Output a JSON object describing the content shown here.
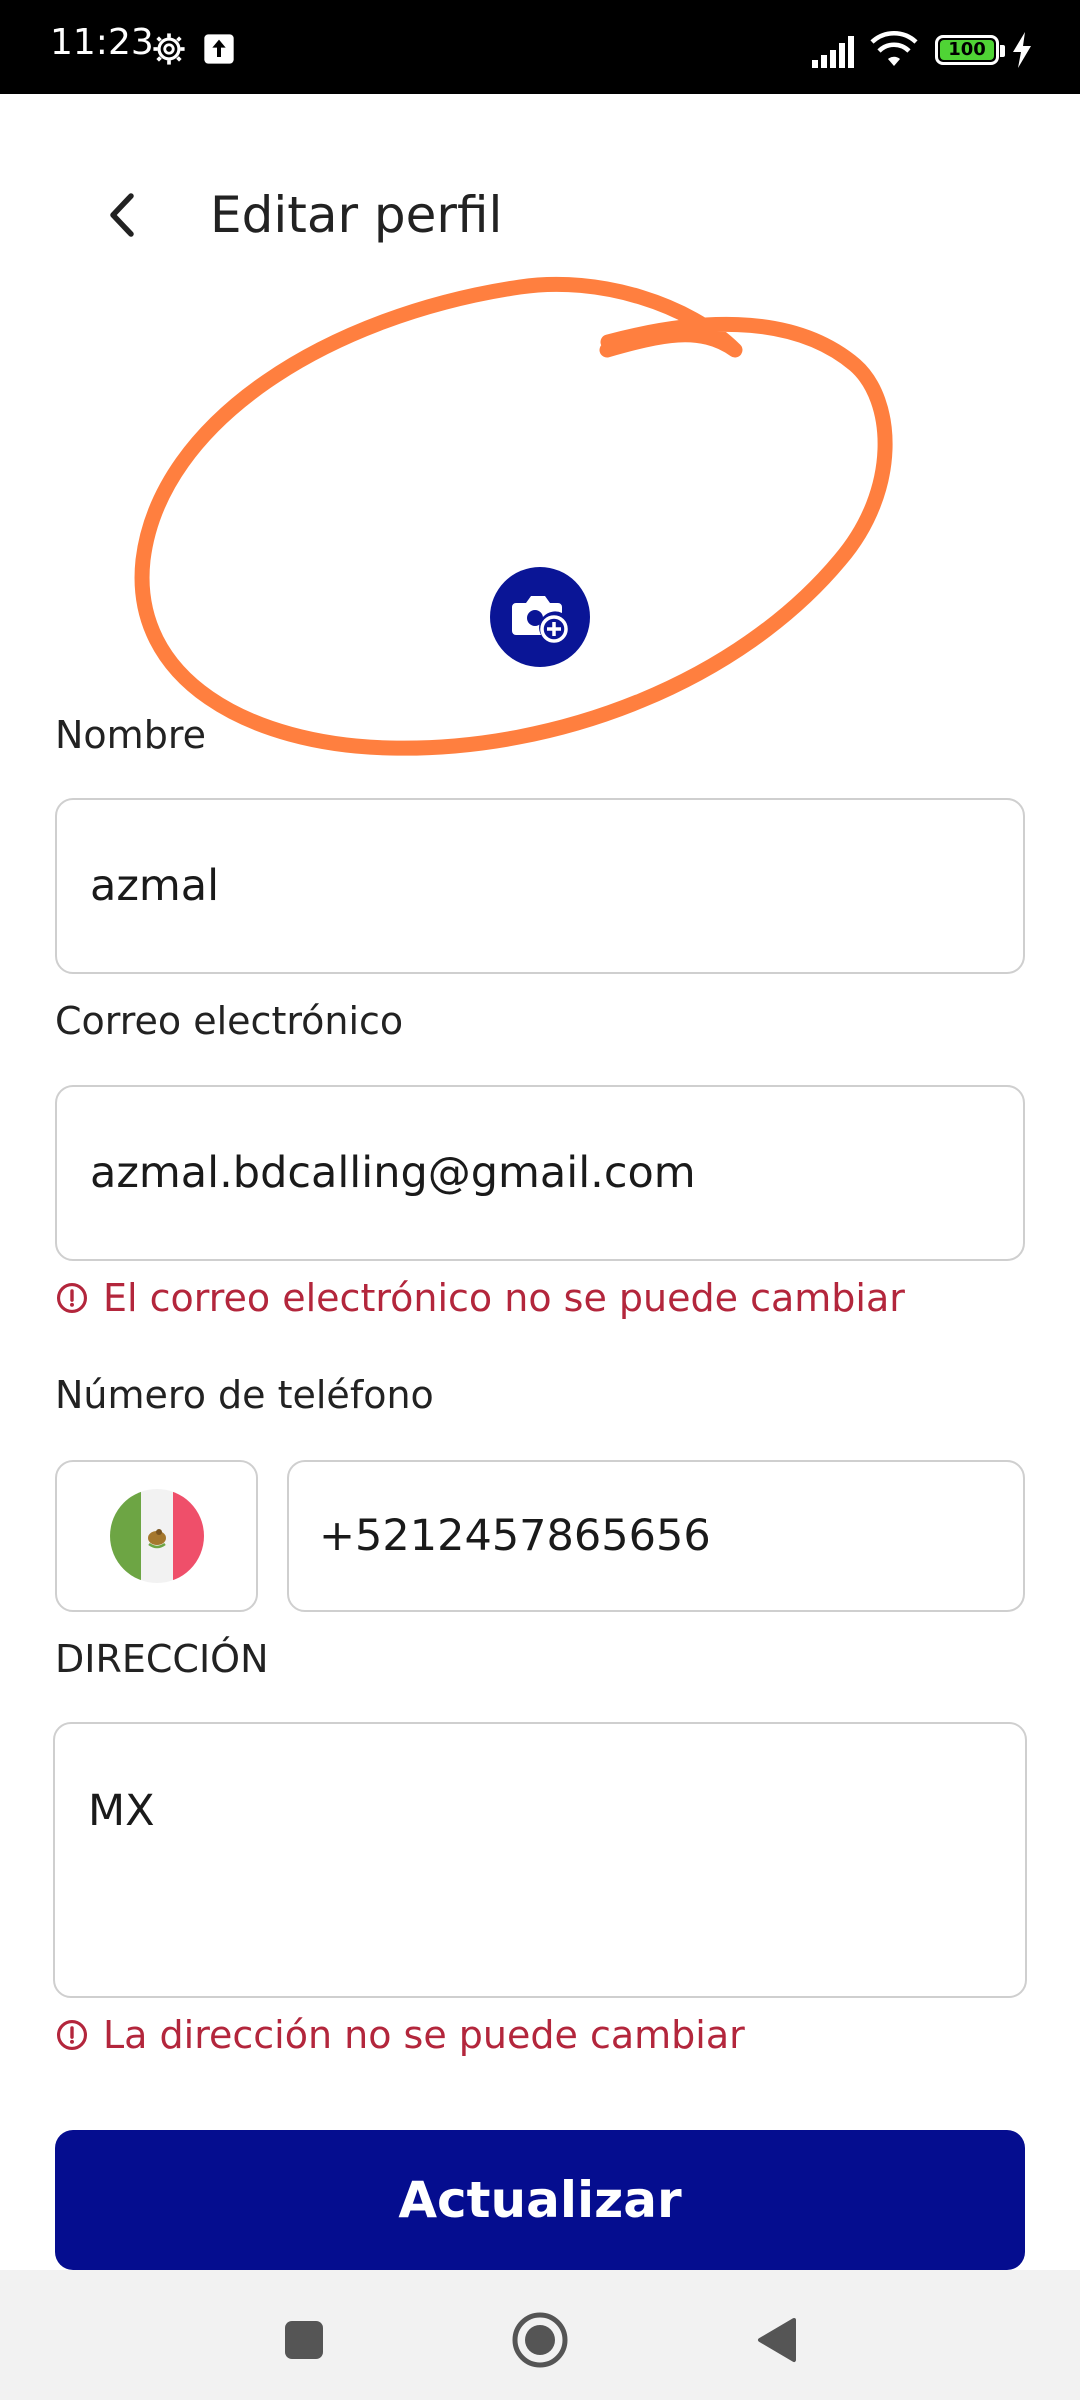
{
  "status_bar": {
    "time": "11:23",
    "battery": "100"
  },
  "header": {
    "title": "Editar perfil"
  },
  "form": {
    "name_label": "Nombre",
    "name_value": "azmal",
    "email_label": "Correo electrónico",
    "email_value": "azmal.bdcalling@gmail.com",
    "email_error": "El correo electrónico no se puede cambiar",
    "phone_label": "Número de teléfono",
    "phone_value": "+5212457865656",
    "address_label": "DIRECCIÓN",
    "address_value": "MX",
    "address_error": "La dirección no se puede cambiar"
  },
  "actions": {
    "update_label": "Actualizar"
  },
  "colors": {
    "primary": "#050d8f",
    "error": "#b3263c",
    "annotation": "#ff7f3f"
  },
  "icons": {
    "back": "chevron-left-icon",
    "avatar": "camera-plus-icon",
    "error": "exclamation-circle-icon",
    "flag": "mexico-flag-icon"
  }
}
